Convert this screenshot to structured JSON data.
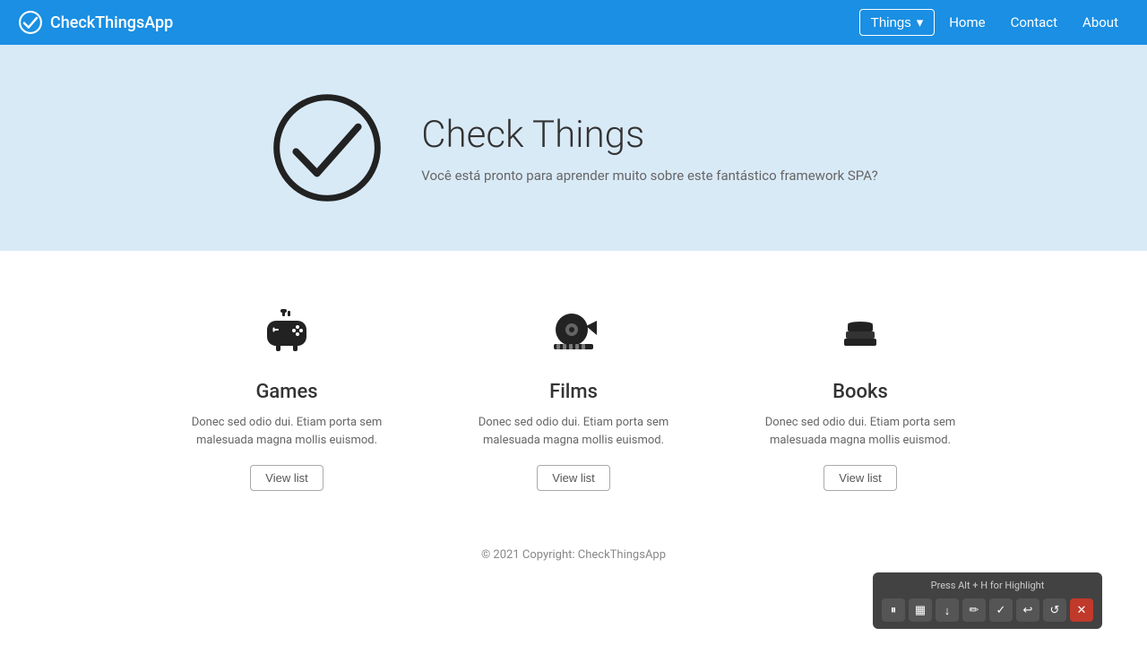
{
  "brand": {
    "name": "CheckThingsApp",
    "logo_alt": "checkmark logo"
  },
  "navbar": {
    "dropdown_label": "Things",
    "dropdown_arrow": "▾",
    "nav_links": [
      {
        "label": "Home",
        "href": "#"
      },
      {
        "label": "Contact",
        "href": "#"
      },
      {
        "label": "About",
        "href": "#"
      }
    ]
  },
  "hero": {
    "title": "Check Things",
    "subtitle": "Você está pronto para aprender muito sobre este fantástico framework SPA?"
  },
  "features": [
    {
      "icon": "🎮",
      "title": "Games",
      "description": "Donec sed odio dui. Etiam porta sem malesuada magna mollis euismod.",
      "button_label": "View list"
    },
    {
      "icon": "🎞️",
      "title": "Films",
      "description": "Donec sed odio dui. Etiam porta sem malesuada magna mollis euismod.",
      "button_label": "View list"
    },
    {
      "icon": "📚",
      "title": "Books",
      "description": "Donec sed odio dui. Etiam porta sem malesuada magna mollis euismod.",
      "button_label": "View list"
    }
  ],
  "footer": {
    "copyright": "© 2021 Copyright: CheckThingsApp"
  },
  "toolbar": {
    "hint": "Press Alt + H for Highlight",
    "buttons": [
      {
        "icon": "⏸",
        "name": "pause"
      },
      {
        "icon": "▦",
        "name": "grid"
      },
      {
        "icon": "↓",
        "name": "download"
      },
      {
        "icon": "✏",
        "name": "pencil"
      },
      {
        "icon": "✓",
        "name": "check"
      },
      {
        "icon": "↩",
        "name": "undo"
      },
      {
        "icon": "↺",
        "name": "redo"
      },
      {
        "icon": "✕",
        "name": "close"
      }
    ]
  }
}
